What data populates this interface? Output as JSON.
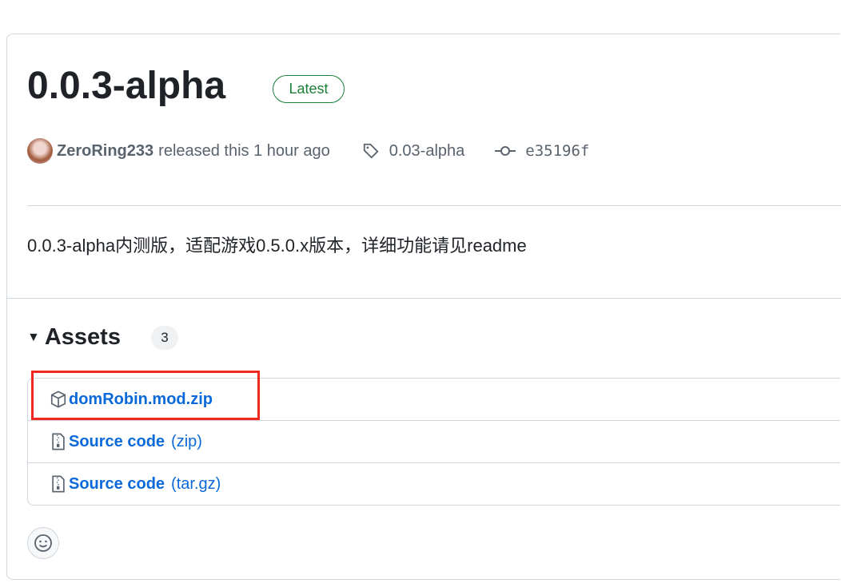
{
  "release": {
    "title": "0.0.3-alpha",
    "badge": "Latest",
    "author": "ZeroRing233",
    "released_text": "released this 1 hour ago",
    "tag": "0.03-alpha",
    "commit": "e35196f",
    "description": "0.0.3-alpha内测版，适配游戏0.5.0.x版本，详细功能请见readme"
  },
  "assets": {
    "heading": "Assets",
    "count": "3",
    "items": [
      {
        "name": "domRobin.mod.zip",
        "suffix": ""
      },
      {
        "name": "Source code",
        "suffix": "(zip)"
      },
      {
        "name": "Source code",
        "suffix": "(tar.gz)"
      }
    ]
  }
}
